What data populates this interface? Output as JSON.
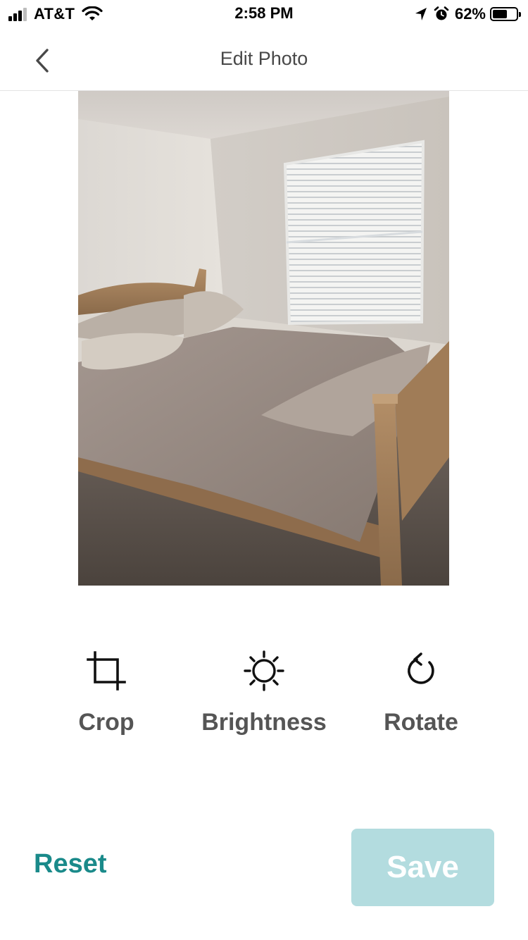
{
  "status_bar": {
    "carrier": "AT&T",
    "time": "2:58 PM",
    "battery_percent": "62%",
    "battery_level": 0.62,
    "icons": [
      "signal-icon",
      "wifi-icon",
      "location-arrow-icon",
      "alarm-icon",
      "battery-icon"
    ]
  },
  "nav": {
    "title": "Edit Photo",
    "back_icon": "chevron-left-icon"
  },
  "photo": {
    "description_icon": "photo-bedroom"
  },
  "tools": [
    {
      "label": "Crop",
      "icon": "crop-icon"
    },
    {
      "label": "Brightness",
      "icon": "sun-icon"
    },
    {
      "label": "Rotate",
      "icon": "rotate-ccw-icon"
    }
  ],
  "footer": {
    "reset_label": "Reset",
    "save_label": "Save"
  },
  "colors": {
    "accent": "#1a8a8a",
    "save_disabled_bg": "#b3dcdf",
    "text": "#484848"
  }
}
